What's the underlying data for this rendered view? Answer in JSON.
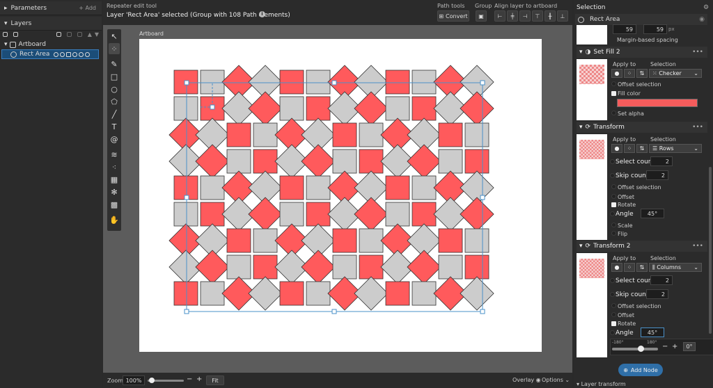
{
  "left_panel": {
    "parameters_title": "Parameters",
    "add_label": "+ Add",
    "layers_title": "Layers",
    "layers": [
      {
        "name": "Artboard"
      },
      {
        "name": "Rect Area"
      }
    ]
  },
  "topbar": {
    "tool_name": "Repeater edit tool",
    "status": "Layer 'Rect Area' selected (Group with 108 Path elements)",
    "path_tools_label": "Path tools",
    "convert_label": "Convert",
    "group_label": "Group",
    "align_label": "Align layer to artboard"
  },
  "canvas": {
    "artboard_label": "Artboard",
    "pattern_colors": {
      "red": "#ff5a5c",
      "gray": "#cccccc",
      "stroke": "#333333",
      "selection": "#4a90c8"
    }
  },
  "bottombar": {
    "zoom_label": "Zoom",
    "zoom_value": "100%",
    "zoom_slider": 0.12,
    "minus": "−",
    "plus": "+",
    "fit_label": "Fit",
    "overlay_label": "Overlay",
    "options_label": "Options"
  },
  "right_panel": {
    "title": "Selection",
    "layer_name": "Rect Area",
    "spacing": {
      "x": "59",
      "y": "59",
      "unit": "px",
      "label": "Margin-based spacing"
    },
    "set_fill": {
      "title": "Set Fill 2",
      "apply_to": "Apply to",
      "selection": "Selection",
      "mode": "Checker",
      "offset_selection": "Offset selection",
      "fill_color_label": "Fill color",
      "fill_color": "#f55c5c",
      "set_alpha": "Set alpha"
    },
    "transform1": {
      "title": "Transform",
      "apply_to": "Apply to",
      "selection": "Selection",
      "mode": "Rows",
      "select_count_label": "Select count",
      "select_count": "2",
      "skip_count_label": "Skip count",
      "skip_count": "2",
      "offset_selection": "Offset selection",
      "offset": "Offset",
      "rotate": "Rotate",
      "angle_label": "Angle",
      "angle": "45°",
      "scale": "Scale",
      "flip": "Flip"
    },
    "transform2": {
      "title": "Transform 2",
      "apply_to": "Apply to",
      "selection": "Selection",
      "mode": "Columns",
      "select_count_label": "Select count",
      "select_count": "2",
      "skip_count_label": "Skip count",
      "skip_count": "2",
      "offset_selection": "Offset selection",
      "offset": "Offset",
      "rotate": "Rotate",
      "angle_label": "Angle",
      "angle": "45°",
      "slider_min": "-180°",
      "slider_max": "180°",
      "slider_value": 0.625,
      "step_minus": "−",
      "step_plus": "+",
      "reset_value": "0°"
    },
    "add_node": "Add Node",
    "layer_transform": "Layer transform"
  }
}
